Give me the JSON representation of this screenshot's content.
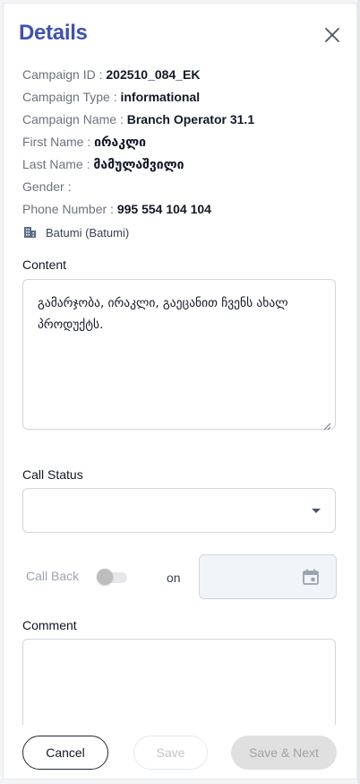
{
  "header": {
    "title": "Details",
    "close_icon": "close-icon"
  },
  "info": {
    "campaign_id": {
      "label": "Campaign ID :",
      "value": "202510_084_EK"
    },
    "campaign_type": {
      "label": "Campaign Type :",
      "value": "informational"
    },
    "campaign_name": {
      "label": "Campaign Name :",
      "value": "Branch Operator 31.1"
    },
    "first_name": {
      "label": "First Name :",
      "value": "ირაკლი"
    },
    "last_name": {
      "label": "Last Name :",
      "value": "მამულაშვილი"
    },
    "gender": {
      "label": "Gender :",
      "value": ""
    },
    "phone": {
      "label": "Phone Number :",
      "value": "995 554 104 104"
    }
  },
  "branch": {
    "icon": "building-icon",
    "text": "Batumi (Batumi)"
  },
  "content": {
    "label": "Content",
    "text": "გამარჯობა, ირაკლი, გაეცანით ჩვენს ახალ პროდუქტს."
  },
  "call_status": {
    "label": "Call Status",
    "value": ""
  },
  "callback": {
    "label": "Call Back",
    "on_label": "on",
    "enabled": false,
    "date": ""
  },
  "comment": {
    "label": "Comment",
    "value": ""
  },
  "footer": {
    "cancel": "Cancel",
    "save": "Save",
    "save_next": "Save & Next"
  },
  "colors": {
    "accent": "#3f51b5",
    "disabled": "#e0e0e0"
  }
}
